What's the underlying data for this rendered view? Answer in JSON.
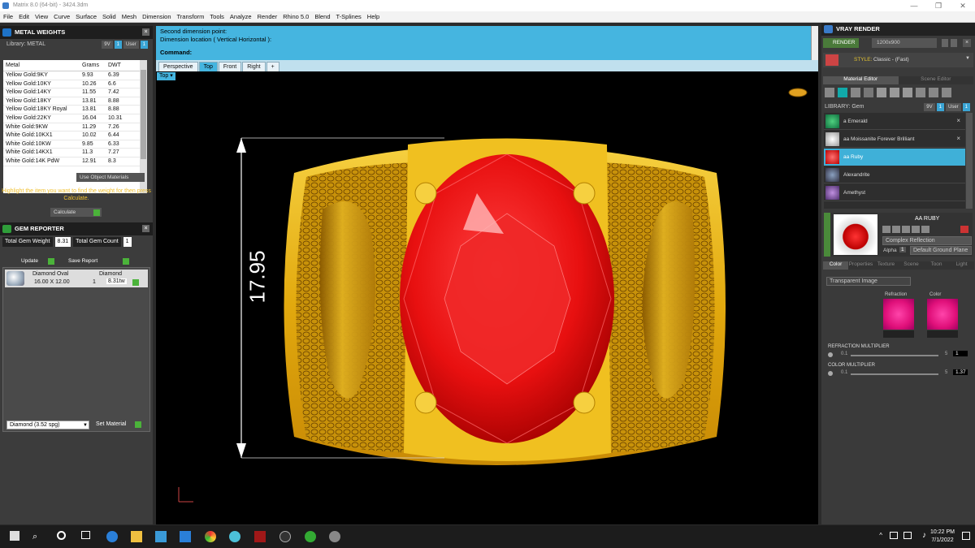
{
  "window": {
    "title": "Matrix 8.0 (64-bit) - 3424.3dm",
    "minimize": "—",
    "maximize": "❐",
    "close": "✕"
  },
  "menu": [
    "File",
    "Edit",
    "View",
    "Curve",
    "Surface",
    "Solid",
    "Mesh",
    "Dimension",
    "Transform",
    "Tools",
    "Analyze",
    "Render",
    "Rhino 5.0",
    "Blend",
    "T-Splines",
    "Help"
  ],
  "metal_weights": {
    "title": "METAL WEIGHTS",
    "library_label": "Library: METAL",
    "btn_9v": "9V",
    "btn_user": "User",
    "columns": [
      "Metal",
      "Grams",
      "DWT"
    ],
    "rows": [
      [
        "Yellow Gold:9KY",
        "9.93",
        "6.39"
      ],
      [
        "Yellow Gold:10KY",
        "10.26",
        "6.6"
      ],
      [
        "Yellow Gold:14KY",
        "11.55",
        "7.42"
      ],
      [
        "Yellow Gold:18KY",
        "13.81",
        "8.88"
      ],
      [
        "Yellow Gold:18KY Royal",
        "13.81",
        "8.88"
      ],
      [
        "Yellow Gold:22KY",
        "16.04",
        "10.31"
      ],
      [
        "White Gold:9KW",
        "11.29",
        "7.26"
      ],
      [
        "White Gold:10KX1",
        "10.02",
        "6.44"
      ],
      [
        "White Gold:10KW",
        "9.85",
        "6.33"
      ],
      [
        "White Gold:14KX1",
        "11.3",
        "7.27"
      ],
      [
        "White Gold:14K PdW",
        "12.91",
        "8.3"
      ]
    ],
    "use_object_materials": "Use Object Materials",
    "hint": "Highlight the item you want to find the weight for then press Calculate.",
    "calculate": "Calculate"
  },
  "gem_reporter": {
    "title": "GEM REPORTER",
    "total_weight_label": "Total Gem Weight",
    "total_weight_value": "8.31",
    "total_count_label": "Total Gem Count",
    "total_count_value": "1",
    "update": "Update",
    "save_report": "Save Report",
    "gem": {
      "shape": "Diamond Oval",
      "size": "16.00 X 12.00",
      "material": "Diamond",
      "qty": "1",
      "weight": "8.31tw"
    },
    "material_select": "Diamond    (3.52 spg)",
    "set_material": "Set Material"
  },
  "command": {
    "line1": "Second dimension point:",
    "line2": "Dimension location ( Vertical  Horizontal ):",
    "prompt": "Command:"
  },
  "viewport_tabs": [
    "Perspective",
    "Top",
    "Front",
    "Right"
  ],
  "active_tab": "Top",
  "viewport_label": "Top",
  "dimension_text": "17.95",
  "vray": {
    "title": "VRAY RENDER",
    "render": "RENDER",
    "resolution": "1200x900",
    "style_label": "STYLE:",
    "style_value": "Classic - (Fast)",
    "tab_material": "Material Editor",
    "tab_scene": "Scene Editor",
    "library_label": "LIBRARY: Gem",
    "materials": [
      "a Emerald",
      "aa Moissanite Forever Brilliant",
      "aa Ruby",
      "Alexandrite",
      "Amethyst"
    ],
    "selected_material": "AA RUBY",
    "reflection": "Complex Reflection",
    "alpha_label": "Alpha",
    "alpha_value": "1",
    "ground": "Default Ground Plane",
    "sub_tabs": [
      "Color",
      "Properties",
      "Texture",
      "Scene",
      "Toon",
      "Light"
    ],
    "image_mode": "Transparent Image",
    "refraction_label": "Refraction",
    "color_label": "Color",
    "refraction_multiplier_label": "REFRACTION MULTIPLIER",
    "color_multiplier_label": "COLOR MULTIPLIER",
    "slider_min": "0.1",
    "slider_max": "5",
    "refraction_multiplier_value": "1",
    "color_multiplier_value": "1.37"
  },
  "taskbar": {
    "time": "10:22 PM",
    "date": "7/1/2022"
  },
  "colors": {
    "accent": "#45b5e0",
    "gold": "#e8b814",
    "ruby": "#e01010"
  }
}
